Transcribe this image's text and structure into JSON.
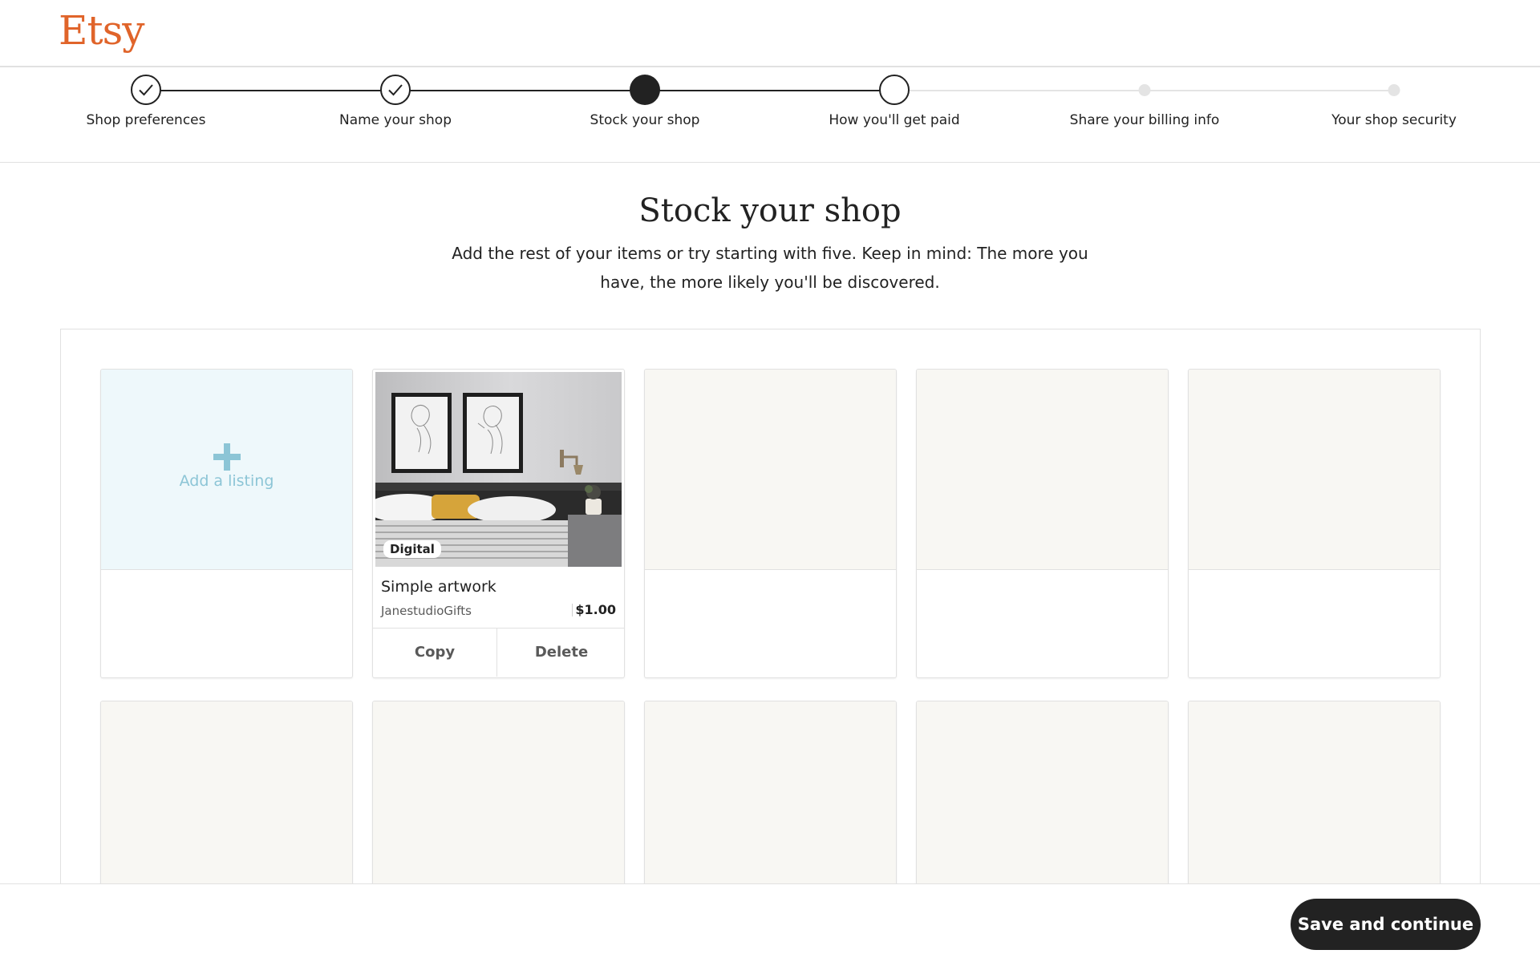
{
  "brand": {
    "logo_text": "Etsy",
    "logo_color": "#e0642a"
  },
  "stepper": {
    "steps": [
      {
        "label": "Shop preferences",
        "state": "completed"
      },
      {
        "label": "Name your shop",
        "state": "completed"
      },
      {
        "label": "Stock your shop",
        "state": "current"
      },
      {
        "label": "How you'll get paid",
        "state": "upcoming"
      },
      {
        "label": "Share your billing info",
        "state": "locked"
      },
      {
        "label": "Your shop security",
        "state": "locked"
      }
    ]
  },
  "intro": {
    "title": "Stock your shop",
    "subtitle": "Add the rest of your items or try starting with five. Keep in mind: The more you have, the more likely you'll be discovered."
  },
  "add_card": {
    "label": "Add a listing",
    "icon": "plus-icon"
  },
  "listing": {
    "badge": "Digital",
    "title": "Simple artwork",
    "shop": "JanestudioGifts",
    "price": "$1.00",
    "copy_label": "Copy",
    "delete_label": "Delete"
  },
  "placeholder_slot_count": 8,
  "footer": {
    "save_label": "Save and continue"
  },
  "colors": {
    "accent": "#e0642a",
    "primary_button": "#222222",
    "add_tint": "#eef8fb",
    "add_icon": "#8cc5d6",
    "placeholder": "#f8f7f3"
  }
}
